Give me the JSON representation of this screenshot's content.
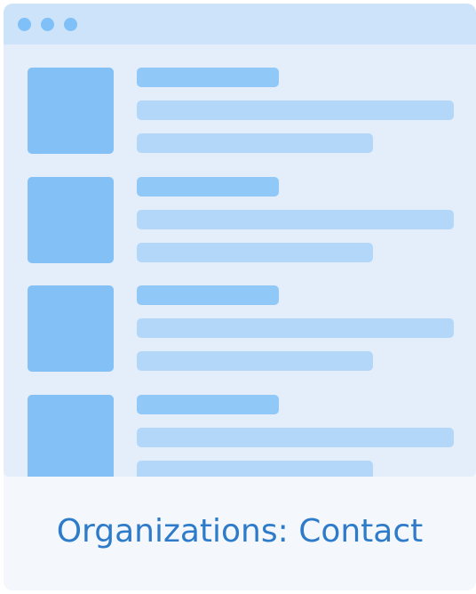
{
  "window": {
    "controls": [
      "window-dot-icon",
      "window-dot-icon",
      "window-dot-icon"
    ]
  },
  "list": {
    "items": [
      {
        "placeholder": true
      },
      {
        "placeholder": true
      },
      {
        "placeholder": true
      },
      {
        "placeholder": true
      }
    ]
  },
  "caption": {
    "text": "Organizations: Contact"
  },
  "colors": {
    "card_background": "#f4f8fd",
    "browser_background": "#e3eefa",
    "titlebar": "#cce3fa",
    "dots": "#7ec0f7",
    "thumbnail": "#82c0f6",
    "title_line": "#90c8f7",
    "text_line": "#b3d7f9",
    "caption_text": "#2d7bc9"
  }
}
